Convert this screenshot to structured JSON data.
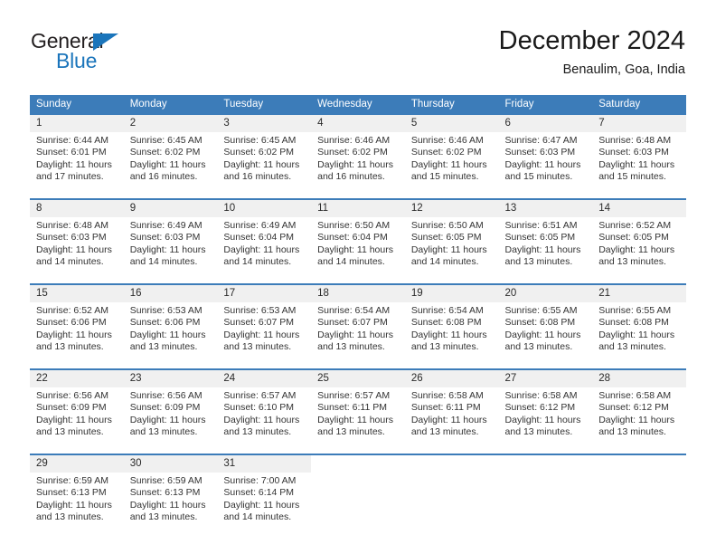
{
  "brand": {
    "name_part1": "General",
    "name_part2": "Blue",
    "triangle_icon": "triangle-icon",
    "colors": {
      "blue": "#1b75bb",
      "dark": "#231f20"
    }
  },
  "header": {
    "title": "December 2024",
    "subtitle": "Benaulim, Goa, India"
  },
  "calendar": {
    "accent_color": "#3c7cb9",
    "daynum_band_color": "#f0f0f0",
    "weekdays": [
      "Sunday",
      "Monday",
      "Tuesday",
      "Wednesday",
      "Thursday",
      "Friday",
      "Saturday"
    ],
    "weeks": [
      [
        {
          "day": "1",
          "sunrise": "Sunrise: 6:44 AM",
          "sunset": "Sunset: 6:01 PM",
          "daylight_line1": "Daylight: 11 hours",
          "daylight_line2": "and 17 minutes."
        },
        {
          "day": "2",
          "sunrise": "Sunrise: 6:45 AM",
          "sunset": "Sunset: 6:02 PM",
          "daylight_line1": "Daylight: 11 hours",
          "daylight_line2": "and 16 minutes."
        },
        {
          "day": "3",
          "sunrise": "Sunrise: 6:45 AM",
          "sunset": "Sunset: 6:02 PM",
          "daylight_line1": "Daylight: 11 hours",
          "daylight_line2": "and 16 minutes."
        },
        {
          "day": "4",
          "sunrise": "Sunrise: 6:46 AM",
          "sunset": "Sunset: 6:02 PM",
          "daylight_line1": "Daylight: 11 hours",
          "daylight_line2": "and 16 minutes."
        },
        {
          "day": "5",
          "sunrise": "Sunrise: 6:46 AM",
          "sunset": "Sunset: 6:02 PM",
          "daylight_line1": "Daylight: 11 hours",
          "daylight_line2": "and 15 minutes."
        },
        {
          "day": "6",
          "sunrise": "Sunrise: 6:47 AM",
          "sunset": "Sunset: 6:03 PM",
          "daylight_line1": "Daylight: 11 hours",
          "daylight_line2": "and 15 minutes."
        },
        {
          "day": "7",
          "sunrise": "Sunrise: 6:48 AM",
          "sunset": "Sunset: 6:03 PM",
          "daylight_line1": "Daylight: 11 hours",
          "daylight_line2": "and 15 minutes."
        }
      ],
      [
        {
          "day": "8",
          "sunrise": "Sunrise: 6:48 AM",
          "sunset": "Sunset: 6:03 PM",
          "daylight_line1": "Daylight: 11 hours",
          "daylight_line2": "and 14 minutes."
        },
        {
          "day": "9",
          "sunrise": "Sunrise: 6:49 AM",
          "sunset": "Sunset: 6:03 PM",
          "daylight_line1": "Daylight: 11 hours",
          "daylight_line2": "and 14 minutes."
        },
        {
          "day": "10",
          "sunrise": "Sunrise: 6:49 AM",
          "sunset": "Sunset: 6:04 PM",
          "daylight_line1": "Daylight: 11 hours",
          "daylight_line2": "and 14 minutes."
        },
        {
          "day": "11",
          "sunrise": "Sunrise: 6:50 AM",
          "sunset": "Sunset: 6:04 PM",
          "daylight_line1": "Daylight: 11 hours",
          "daylight_line2": "and 14 minutes."
        },
        {
          "day": "12",
          "sunrise": "Sunrise: 6:50 AM",
          "sunset": "Sunset: 6:05 PM",
          "daylight_line1": "Daylight: 11 hours",
          "daylight_line2": "and 14 minutes."
        },
        {
          "day": "13",
          "sunrise": "Sunrise: 6:51 AM",
          "sunset": "Sunset: 6:05 PM",
          "daylight_line1": "Daylight: 11 hours",
          "daylight_line2": "and 13 minutes."
        },
        {
          "day": "14",
          "sunrise": "Sunrise: 6:52 AM",
          "sunset": "Sunset: 6:05 PM",
          "daylight_line1": "Daylight: 11 hours",
          "daylight_line2": "and 13 minutes."
        }
      ],
      [
        {
          "day": "15",
          "sunrise": "Sunrise: 6:52 AM",
          "sunset": "Sunset: 6:06 PM",
          "daylight_line1": "Daylight: 11 hours",
          "daylight_line2": "and 13 minutes."
        },
        {
          "day": "16",
          "sunrise": "Sunrise: 6:53 AM",
          "sunset": "Sunset: 6:06 PM",
          "daylight_line1": "Daylight: 11 hours",
          "daylight_line2": "and 13 minutes."
        },
        {
          "day": "17",
          "sunrise": "Sunrise: 6:53 AM",
          "sunset": "Sunset: 6:07 PM",
          "daylight_line1": "Daylight: 11 hours",
          "daylight_line2": "and 13 minutes."
        },
        {
          "day": "18",
          "sunrise": "Sunrise: 6:54 AM",
          "sunset": "Sunset: 6:07 PM",
          "daylight_line1": "Daylight: 11 hours",
          "daylight_line2": "and 13 minutes."
        },
        {
          "day": "19",
          "sunrise": "Sunrise: 6:54 AM",
          "sunset": "Sunset: 6:08 PM",
          "daylight_line1": "Daylight: 11 hours",
          "daylight_line2": "and 13 minutes."
        },
        {
          "day": "20",
          "sunrise": "Sunrise: 6:55 AM",
          "sunset": "Sunset: 6:08 PM",
          "daylight_line1": "Daylight: 11 hours",
          "daylight_line2": "and 13 minutes."
        },
        {
          "day": "21",
          "sunrise": "Sunrise: 6:55 AM",
          "sunset": "Sunset: 6:08 PM",
          "daylight_line1": "Daylight: 11 hours",
          "daylight_line2": "and 13 minutes."
        }
      ],
      [
        {
          "day": "22",
          "sunrise": "Sunrise: 6:56 AM",
          "sunset": "Sunset: 6:09 PM",
          "daylight_line1": "Daylight: 11 hours",
          "daylight_line2": "and 13 minutes."
        },
        {
          "day": "23",
          "sunrise": "Sunrise: 6:56 AM",
          "sunset": "Sunset: 6:09 PM",
          "daylight_line1": "Daylight: 11 hours",
          "daylight_line2": "and 13 minutes."
        },
        {
          "day": "24",
          "sunrise": "Sunrise: 6:57 AM",
          "sunset": "Sunset: 6:10 PM",
          "daylight_line1": "Daylight: 11 hours",
          "daylight_line2": "and 13 minutes."
        },
        {
          "day": "25",
          "sunrise": "Sunrise: 6:57 AM",
          "sunset": "Sunset: 6:11 PM",
          "daylight_line1": "Daylight: 11 hours",
          "daylight_line2": "and 13 minutes."
        },
        {
          "day": "26",
          "sunrise": "Sunrise: 6:58 AM",
          "sunset": "Sunset: 6:11 PM",
          "daylight_line1": "Daylight: 11 hours",
          "daylight_line2": "and 13 minutes."
        },
        {
          "day": "27",
          "sunrise": "Sunrise: 6:58 AM",
          "sunset": "Sunset: 6:12 PM",
          "daylight_line1": "Daylight: 11 hours",
          "daylight_line2": "and 13 minutes."
        },
        {
          "day": "28",
          "sunrise": "Sunrise: 6:58 AM",
          "sunset": "Sunset: 6:12 PM",
          "daylight_line1": "Daylight: 11 hours",
          "daylight_line2": "and 13 minutes."
        }
      ],
      [
        {
          "day": "29",
          "sunrise": "Sunrise: 6:59 AM",
          "sunset": "Sunset: 6:13 PM",
          "daylight_line1": "Daylight: 11 hours",
          "daylight_line2": "and 13 minutes."
        },
        {
          "day": "30",
          "sunrise": "Sunrise: 6:59 AM",
          "sunset": "Sunset: 6:13 PM",
          "daylight_line1": "Daylight: 11 hours",
          "daylight_line2": "and 13 minutes."
        },
        {
          "day": "31",
          "sunrise": "Sunrise: 7:00 AM",
          "sunset": "Sunset: 6:14 PM",
          "daylight_line1": "Daylight: 11 hours",
          "daylight_line2": "and 14 minutes."
        },
        {
          "day": "",
          "sunrise": "",
          "sunset": "",
          "daylight_line1": "",
          "daylight_line2": ""
        },
        {
          "day": "",
          "sunrise": "",
          "sunset": "",
          "daylight_line1": "",
          "daylight_line2": ""
        },
        {
          "day": "",
          "sunrise": "",
          "sunset": "",
          "daylight_line1": "",
          "daylight_line2": ""
        },
        {
          "day": "",
          "sunrise": "",
          "sunset": "",
          "daylight_line1": "",
          "daylight_line2": ""
        }
      ]
    ]
  }
}
